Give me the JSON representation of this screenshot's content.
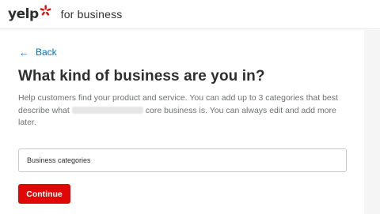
{
  "header": {
    "logo_text": "yelp",
    "logo_icon": "yelp-burst-icon",
    "section_label": "for business"
  },
  "back": {
    "icon": "arrow-left-icon",
    "label": "Back"
  },
  "main": {
    "title": "What kind of business are you in?",
    "description_part1": "Help customers find your product and service. You can add up to 3 categories that best describe what",
    "description_part2": "core business is. You can always edit and add more later."
  },
  "category_input": {
    "placeholder": "Business categories",
    "value": ""
  },
  "continue_button": {
    "label": "Continue"
  },
  "colors": {
    "brand_red": "#e00707",
    "link_blue": "#0073bb",
    "text_dark": "#2d2e2f",
    "text_muted": "#6e7072"
  }
}
